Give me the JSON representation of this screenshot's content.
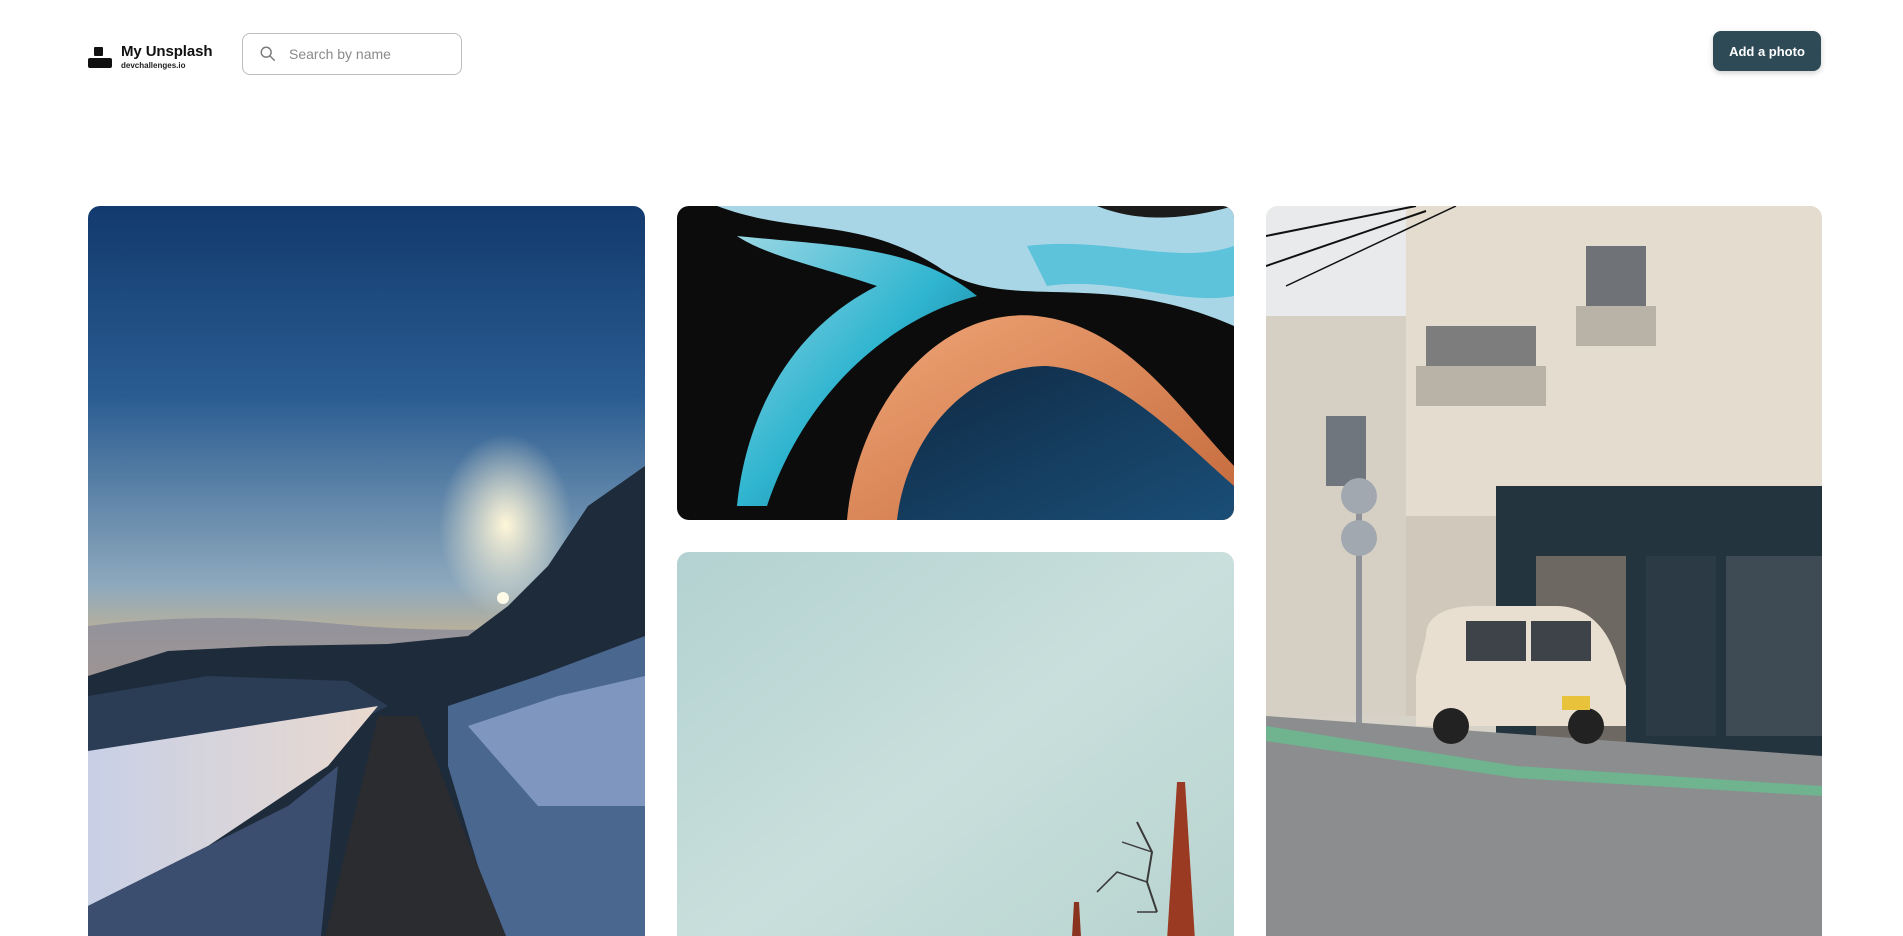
{
  "header": {
    "logo": {
      "title": "My Unsplash",
      "subtitle": "devchallenges.io"
    },
    "search": {
      "placeholder": "Search by name",
      "value": ""
    },
    "add_button_label": "Add a photo"
  },
  "gallery": {
    "photos": [
      {
        "description": "snowy road at sunset with pine trees"
      },
      {
        "description": "abstract blue and orange waves"
      },
      {
        "description": "pale teal sky with red spire and branches"
      },
      {
        "description": "building with parked white car on street"
      }
    ]
  },
  "colors": {
    "accent": "#2e4a57",
    "border": "#bdbdbd",
    "background": "#ffffff"
  }
}
